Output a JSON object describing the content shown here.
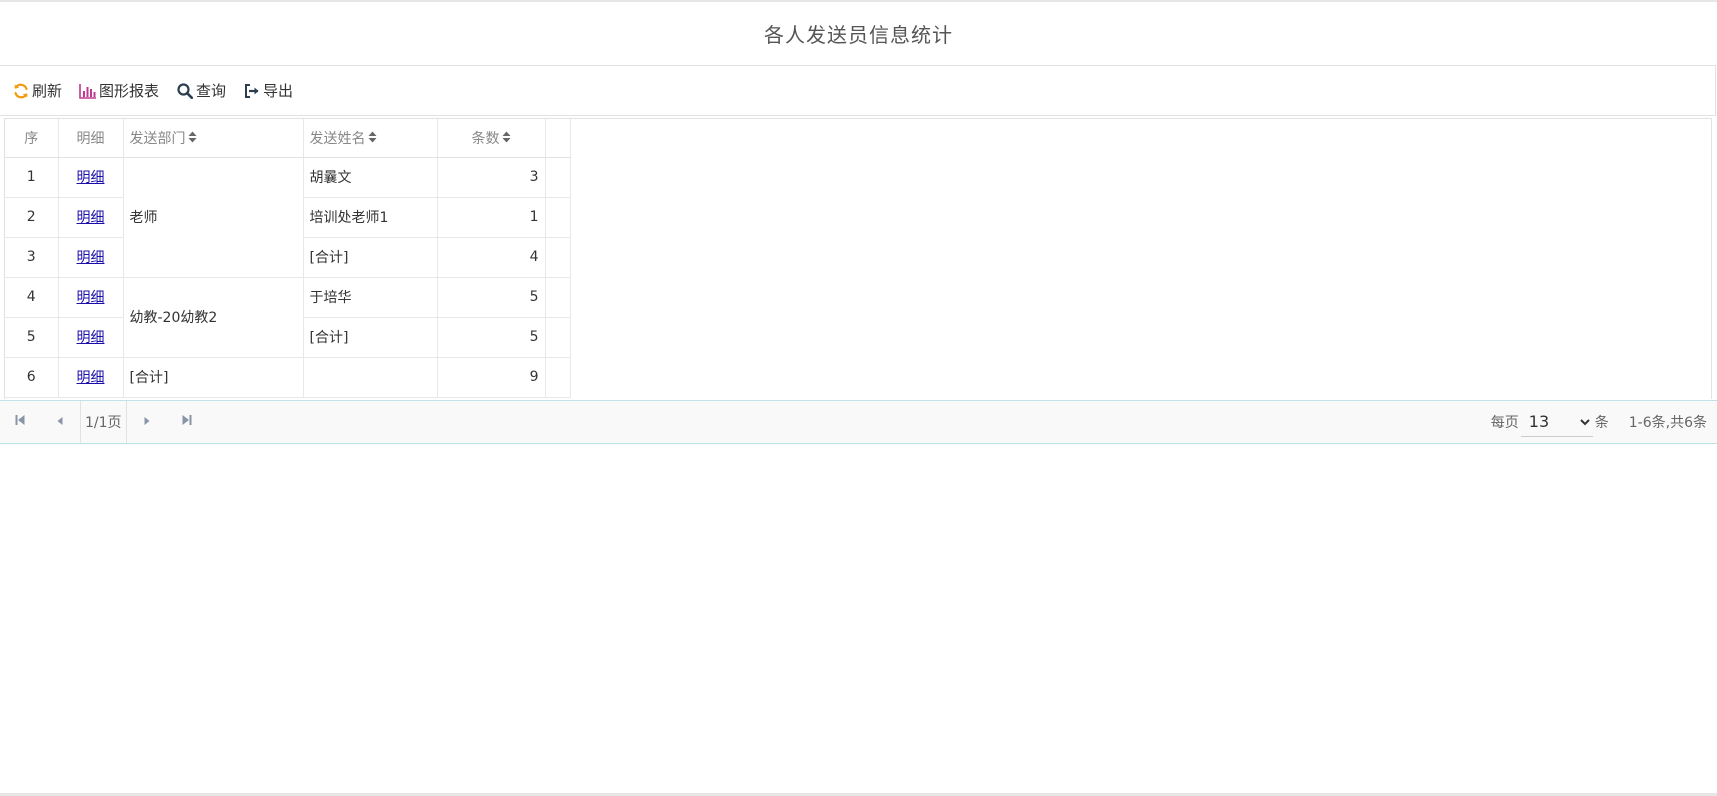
{
  "page_title": "各人发送员信息统计",
  "toolbar": {
    "refresh_label": "刷新",
    "chart_label": "图形报表",
    "search_label": "查询",
    "export_label": "导出",
    "refresh_color": "#f39c12",
    "chart_color": "#c0398e",
    "search_color": "#2c3e50",
    "export_color": "#2c3e50"
  },
  "grid": {
    "headers": {
      "index": "序",
      "detail": "明细",
      "department": "发送部门",
      "sender": "发送姓名",
      "count": "条数"
    },
    "rows": [
      {
        "index": "1",
        "detail": "明细",
        "sender": "胡曩文",
        "count": "3"
      },
      {
        "index": "2",
        "detail": "明细",
        "sender": "培训处老师1",
        "count": "1"
      },
      {
        "index": "3",
        "detail": "明细",
        "sender": "[合计]",
        "count": "4"
      },
      {
        "index": "4",
        "detail": "明细",
        "sender": "于培华",
        "count": "5"
      },
      {
        "index": "5",
        "detail": "明细",
        "sender": "[合计]",
        "count": "5"
      },
      {
        "index": "6",
        "detail": "明细",
        "sender": "",
        "count": "9"
      }
    ],
    "departments": {
      "group1": "老师",
      "group2": "幼教-20幼教2",
      "total": "[合计]"
    },
    "link_color": "#1a0dab"
  },
  "pager": {
    "page_info": "1/1页",
    "per_page_prefix": "每页",
    "per_page_value": "13",
    "per_page_suffix": "条",
    "summary": "1-6条,共6条",
    "border_color": "#bfe1ea"
  },
  "icons": {
    "refresh": "refresh-icon",
    "chart": "bar-chart-icon",
    "search": "search-icon",
    "export": "export-icon",
    "sort": "sort-icon",
    "first": "first-page-icon",
    "prev": "prev-page-icon",
    "next": "next-page-icon",
    "last": "last-page-icon"
  }
}
